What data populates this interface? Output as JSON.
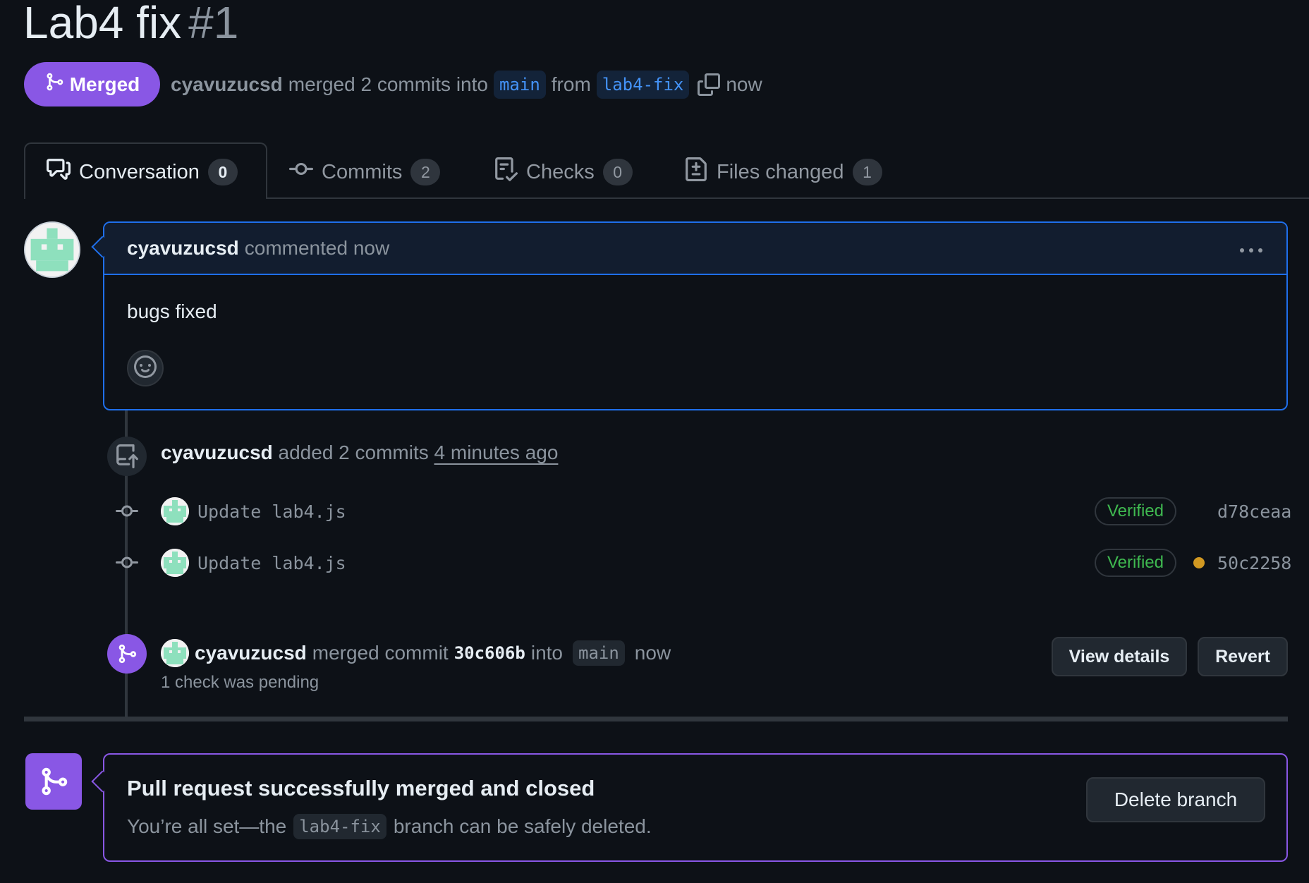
{
  "pr": {
    "title": "Lab4 fix",
    "number": "#1",
    "status": "Merged",
    "author": "cyavuzucsd",
    "merged_text": "merged 2 commits into",
    "base_branch": "main",
    "from_text": "from",
    "head_branch": "lab4-fix",
    "time": "now"
  },
  "tabs": [
    {
      "label": "Conversation",
      "count": "0",
      "icon": "comment-discussion-icon"
    },
    {
      "label": "Commits",
      "count": "2",
      "icon": "git-commit-icon"
    },
    {
      "label": "Checks",
      "count": "0",
      "icon": "checklist-icon"
    },
    {
      "label": "Files changed",
      "count": "1",
      "icon": "file-diff-icon"
    }
  ],
  "comment": {
    "author": "cyavuzucsd",
    "action": "commented now",
    "body": "bugs fixed"
  },
  "commits_event": {
    "author": "cyavuzucsd",
    "action": "added 2 commits",
    "time": "4 minutes ago",
    "commits": [
      {
        "message": "Update lab4.js",
        "verified": "Verified",
        "sha": "d78ceaa",
        "status": ""
      },
      {
        "message": "Update lab4.js",
        "verified": "Verified",
        "sha": "50c2258",
        "status": "pending"
      }
    ]
  },
  "merge_event": {
    "author": "cyavuzucsd",
    "action": "merged commit",
    "sha": "30c606b",
    "into_text": "into",
    "branch": "main",
    "time": "now",
    "checks_text": "1 check was pending",
    "view_details_label": "View details",
    "revert_label": "Revert"
  },
  "merged_box": {
    "heading": "Pull request successfully merged and closed",
    "desc_prefix": "You’re all set—the",
    "branch": "lab4-fix",
    "desc_suffix": "branch can be safely deleted.",
    "delete_label": "Delete branch"
  },
  "colors": {
    "background": "#0d1117",
    "merged_purple": "#8957e5",
    "accent_blue": "#1f6feb",
    "verified_green": "#3fb950",
    "pending_yellow": "#d29922"
  }
}
